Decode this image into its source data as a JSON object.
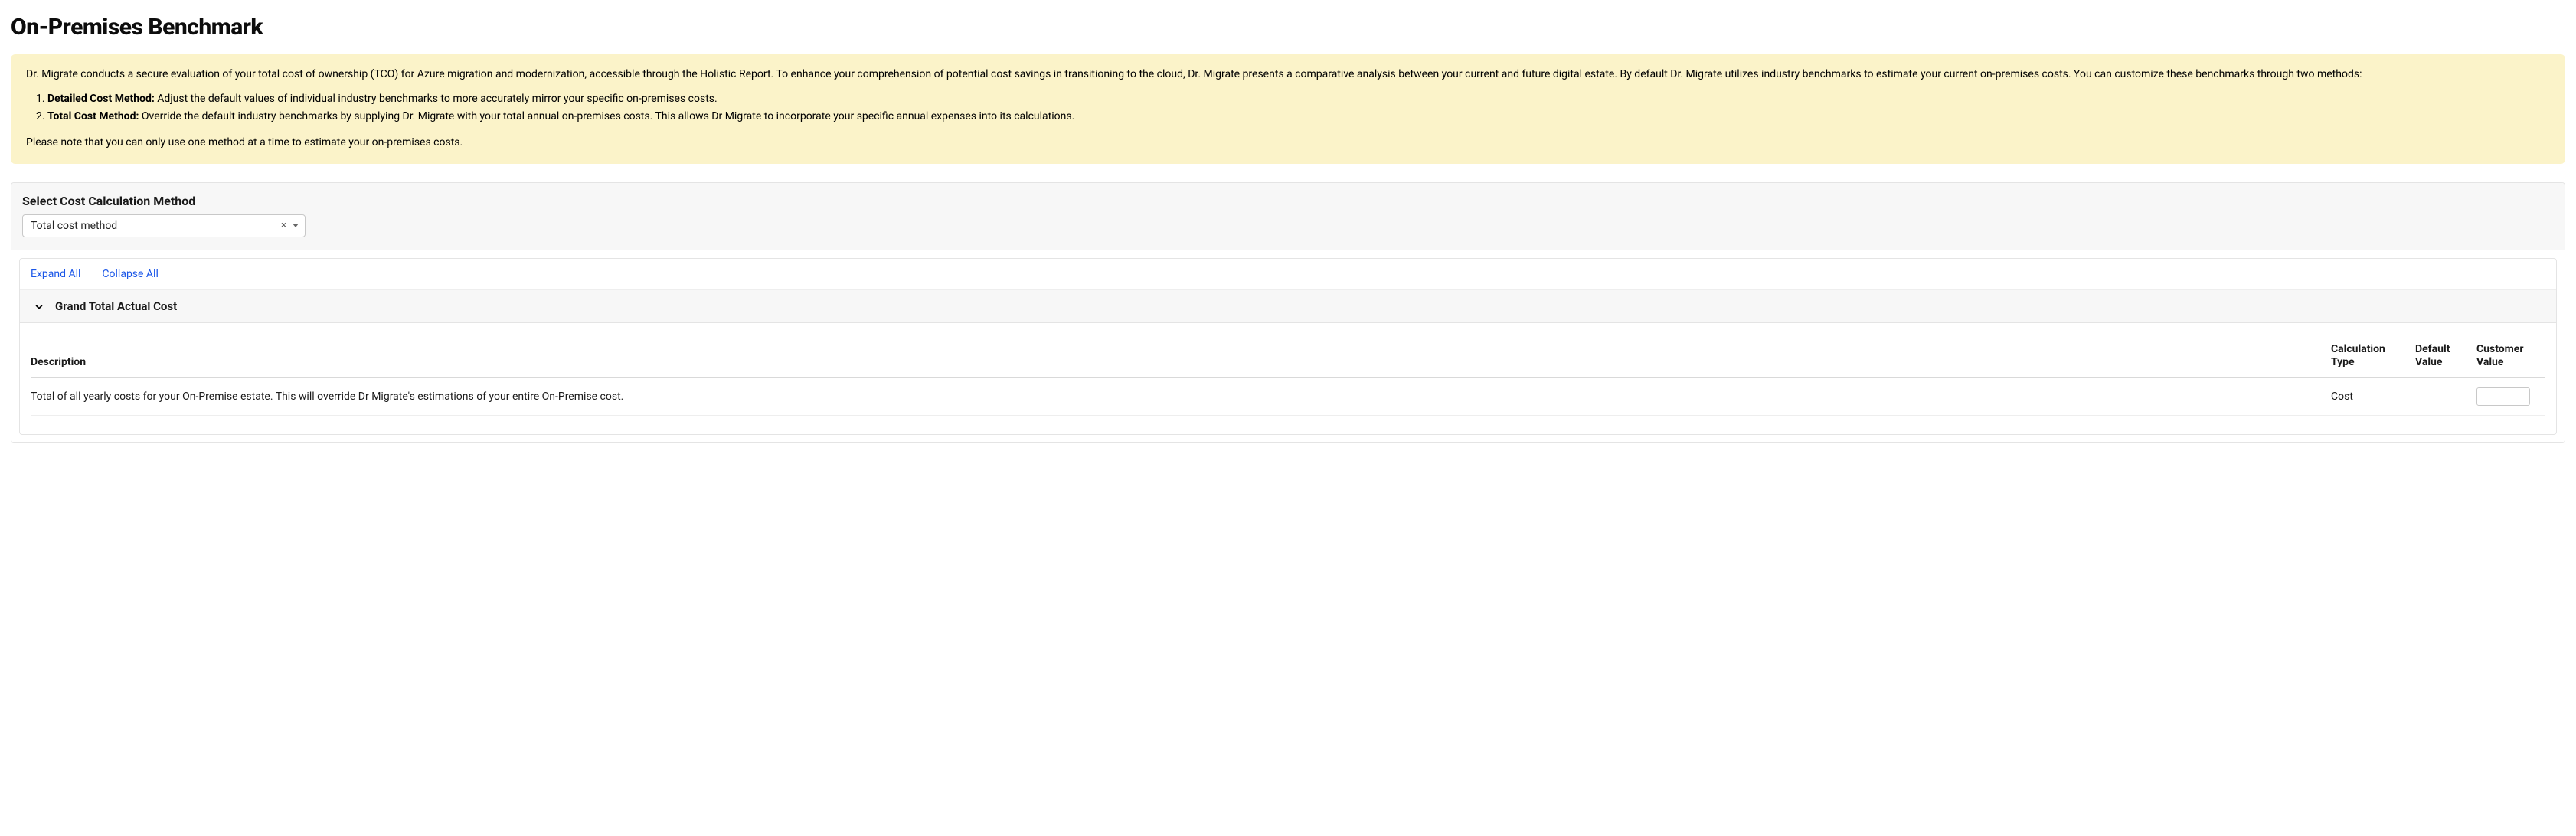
{
  "title": "On-Premises Benchmark",
  "notice": {
    "intro": "Dr. Migrate conducts a secure evaluation of your total cost of ownership (TCO) for Azure migration and modernization, accessible through the Holistic Report. To enhance your comprehension of potential cost savings in transitioning to the cloud, Dr. Migrate presents a comparative analysis between your current and future digital estate. By default Dr. Migrate utilizes industry benchmarks to estimate your current on-premises costs. You can customize these benchmarks through two methods:",
    "methods": [
      {
        "label": "Detailed Cost Method:",
        "text": " Adjust the default values of individual industry benchmarks to more accurately mirror your specific on-premises costs."
      },
      {
        "label": "Total Cost Method:",
        "text": " Override the default industry benchmarks by supplying Dr. Migrate with your total annual on-premises costs. This allows Dr Migrate to incorporate your specific annual expenses into its calculations."
      }
    ],
    "footer": "Please note that you can only use one method at a time to estimate your on-premises costs."
  },
  "panel": {
    "select_label": "Select Cost Calculation Method",
    "select_value": "Total cost method"
  },
  "actions": {
    "expand_all": "Expand All",
    "collapse_all": "Collapse All"
  },
  "section": {
    "title": "Grand Total Actual Cost",
    "columns": {
      "description": "Description",
      "calc_type": "Calculation Type",
      "default_value": "Default Value",
      "customer_value": "Customer Value"
    },
    "rows": [
      {
        "description": "Total of all yearly costs for your On-Premise estate. This will override Dr Migrate's estimations of your entire On-Premise cost.",
        "calc_type": "Cost",
        "default_value": "",
        "customer_value": ""
      }
    ]
  }
}
